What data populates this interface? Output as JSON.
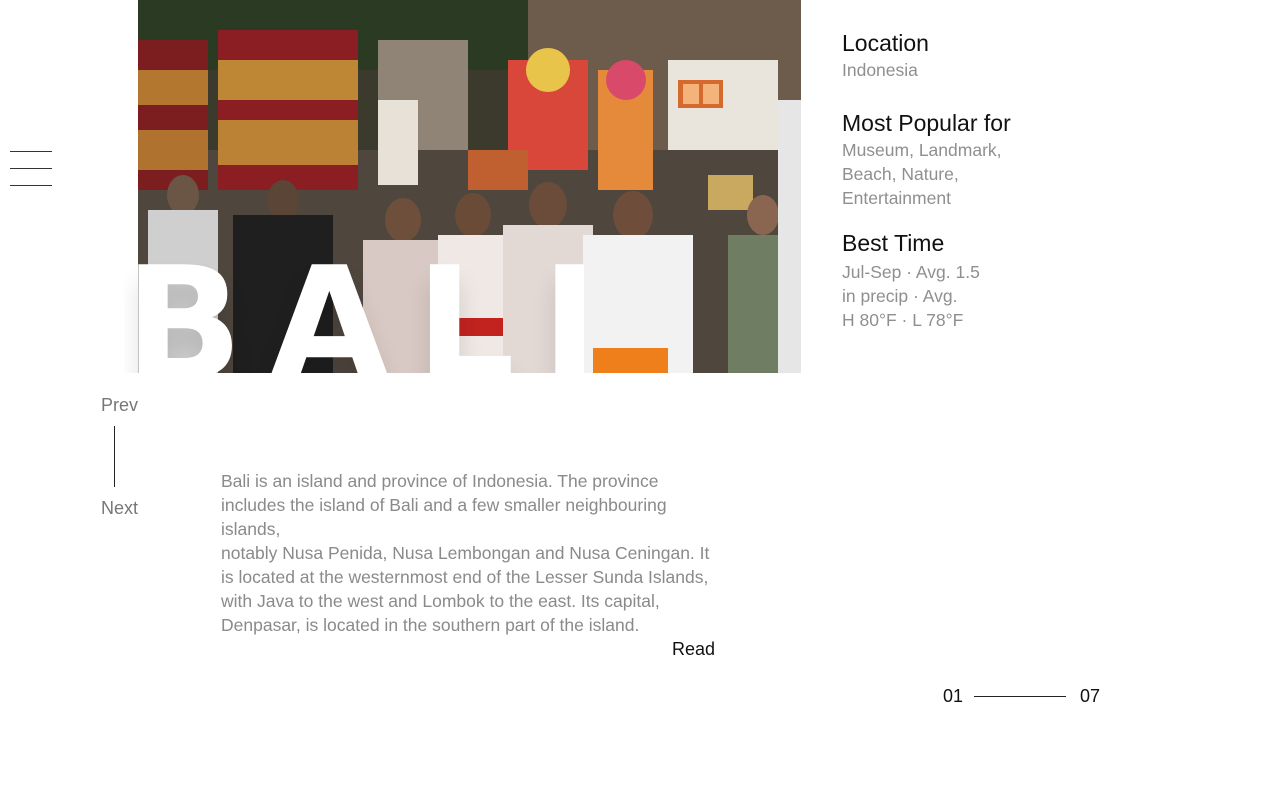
{
  "hero": {
    "title": "BALI",
    "image_alt": "Balinese women carrying ceremonial offerings on their heads during a temple procession"
  },
  "nav": {
    "menu_icon": "hamburger-menu-icon",
    "prev_label": "Prev",
    "next_label": "Next"
  },
  "description": {
    "lines": [
      "Bali is an island and province of Indonesia. The province",
      "includes the island of  Bali and a few smaller neighbouring islands,",
      "notably Nusa  Penida, Nusa  Lembongan and Nusa Ceningan. It",
      "is located at the  westernmost end of the  Lesser Sunda Islands,",
      "with Java to the west and Lombok  to the east. Its capital,",
      "Denpasar, is located in the southern part of the island."
    ],
    "read_label": "Read"
  },
  "info": {
    "location": {
      "heading": "Location",
      "value": "Indonesia"
    },
    "popular": {
      "heading": "Most Popular for",
      "lines": [
        "Museum, Landmark,",
        "Beach, Nature,",
        "Entertainment"
      ]
    },
    "best_time": {
      "heading": "Best Time",
      "lines": [
        "Jul-Sep · Avg. 1.5",
        "in precip · Avg.",
        "H 80°F · L 78°F"
      ]
    }
  },
  "pagination": {
    "current": "01",
    "total": "07"
  },
  "colors": {
    "background": "#ffffff",
    "text_primary": "#111111",
    "text_muted": "#8a8a8a",
    "title_fill": "#ffffff"
  }
}
